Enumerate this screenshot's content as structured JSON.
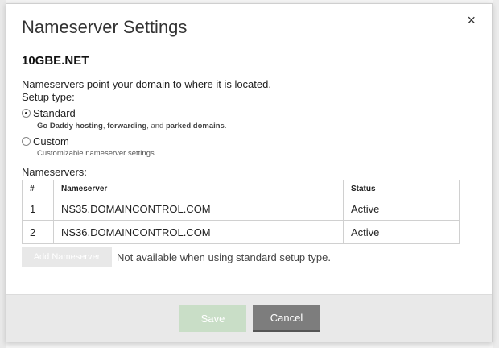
{
  "dialog": {
    "title": "Nameserver Settings",
    "close_symbol": "×",
    "domain": "10GBE.NET",
    "description": "Nameservers point your domain to where it is located.",
    "setup_type_label": "Setup type:",
    "options": {
      "standard": {
        "label": "Standard",
        "selected": true,
        "help_parts": [
          "Go Daddy hosting",
          ", ",
          "forwarding",
          ", and ",
          "parked domains",
          "."
        ]
      },
      "custom": {
        "label": "Custom",
        "selected": false,
        "help": "Customizable nameserver settings."
      }
    },
    "nameservers_label": "Nameservers:",
    "table": {
      "headers": [
        "#",
        "Nameserver",
        "Status"
      ],
      "rows": [
        {
          "num": "1",
          "nameserver": "NS35.DOMAINCONTROL.COM",
          "status": "Active"
        },
        {
          "num": "2",
          "nameserver": "NS36.DOMAINCONTROL.COM",
          "status": "Active"
        }
      ]
    },
    "add_button": {
      "label": "Add Nameserver",
      "disabled": true
    },
    "add_note": "Not available when using standard setup type.",
    "footer": {
      "save_label": "Save",
      "save_disabled": true,
      "cancel_label": "Cancel"
    }
  },
  "colors": {
    "save_disabled_bg": "#c9dec7",
    "cancel_bg": "#7d7d7d",
    "footer_bg": "#e9e9e9"
  }
}
